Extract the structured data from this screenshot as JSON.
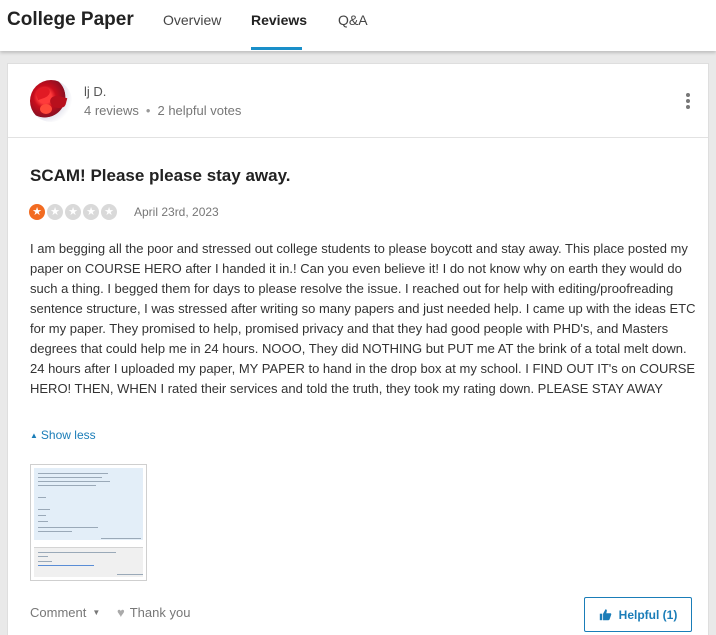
{
  "header": {
    "brand": "College Paper",
    "tabs": [
      {
        "label": "Overview"
      },
      {
        "label": "Reviews"
      },
      {
        "label": "Q&A"
      }
    ]
  },
  "review": {
    "author_name": "lj D.",
    "author_reviews": "4 reviews",
    "author_helpful_votes": "2 helpful votes",
    "title": "SCAM! Please please stay away.",
    "rating": 1,
    "rating_max": 5,
    "date": "April 23rd, 2023",
    "body": "I am begging all the poor and stressed out college students to please boycott and stay away. This place posted my paper on COURSE HERO after I handed it in.! Can you even believe it! I do not know why on earth they would do such a thing. I begged them for days to please resolve the issue. I reached out for help with editing/proofreading sentence structure, I was stressed after writing so many papers and just needed help. I came up with the ideas ETC for my paper. They promised to help, promised privacy and that they had good people with PHD's, and Masters degrees that could help me in 24 hours. NOOO, They did NOTHING but PUT me AT the brink of a total melt down. 24 hours after I uploaded my paper, MY PAPER to hand in the drop box at my school. I FIND OUT IT's on COURSE HERO! THEN, WHEN I rated their services and told the truth, they took my rating down. PLEASE STAY AWAY",
    "show_less_label": "Show less",
    "comment_label": "Comment",
    "thank_you_label": "Thank you",
    "helpful_label": "Helpful (1)"
  },
  "colors": {
    "accent": "#1a7db8",
    "star_active": "#f26b21",
    "star_inactive": "#d9d9d9",
    "tab_underline": "#1a8fc9"
  },
  "icons": {
    "more": "kebab-menu-icon",
    "star": "star-icon",
    "caret": "caret-up-icon",
    "comment_dropdown": "chevron-down-icon",
    "heart": "heart-icon",
    "thumbs_up": "thumbs-up-icon"
  }
}
